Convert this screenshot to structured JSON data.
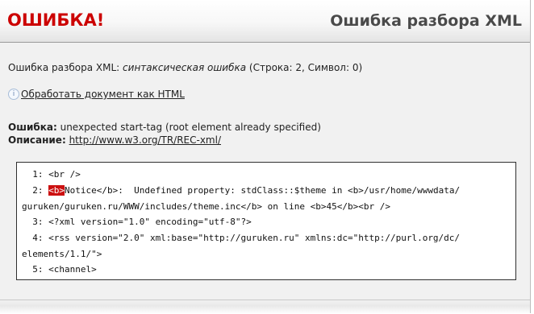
{
  "header": {
    "brand": "ОШИБКА!",
    "title": "Ошибка разбора XML"
  },
  "summary": {
    "prefix": "Ошибка разбора XML: ",
    "error_type": "синтаксическая ошибка",
    "position": " (Строка: 2, Символ: 0)"
  },
  "action": {
    "icon": "info-icon",
    "link_label": "Обработать документ как HTML"
  },
  "details": {
    "error_label": "Ошибка:",
    "error_text": " unexpected start-tag (root element already specified)",
    "desc_label": "Описание:",
    "desc_link": "http://www.w3.org/TR/REC-xml/"
  },
  "code": {
    "line1": "  1: <br />",
    "line2_prefix": "  2: ",
    "line2_highlight": "<b>",
    "line2_rest": "Notice</b>:  Undefined property: stdClass::$theme in <b>/usr/home/wwwdata/",
    "line2_wrap": "guruken/guruken.ru/WWW/includes/theme.inc</b> on line <b>45</b><br />",
    "line3": "  3: <?xml version=\"1.0\" encoding=\"utf-8\"?>",
    "line4": "  4: <rss version=\"2.0\" xml:base=\"http://guruken.ru\" xmlns:dc=\"http://purl.org/dc/",
    "line4_wrap": "elements/1.1/\">",
    "line5": "  5: <channel>"
  }
}
